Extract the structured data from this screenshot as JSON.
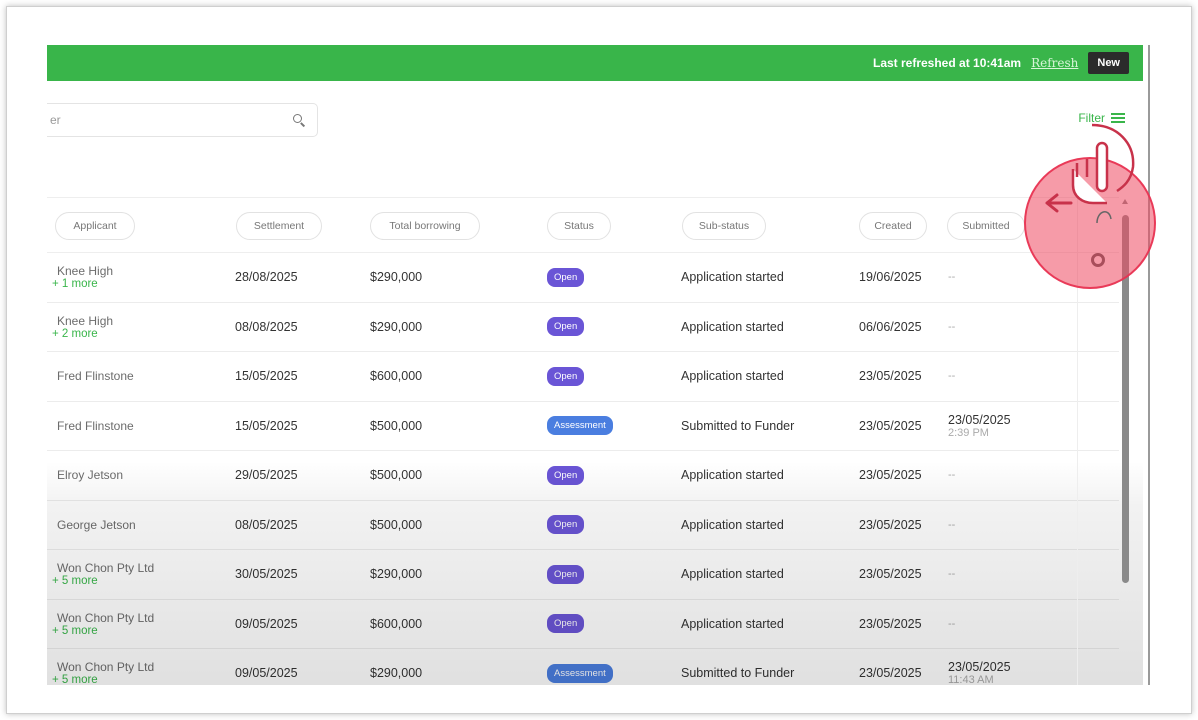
{
  "topbar": {
    "last_refreshed": "Last refreshed at 10:41am",
    "refresh_label": "Refresh",
    "new_label": "New",
    "color": "#39b54a"
  },
  "search": {
    "placeholder": "er"
  },
  "filter": {
    "label": "Filter"
  },
  "columns": [
    "Applicant",
    "Settlement",
    "Total borrowing",
    "Status",
    "Sub-status",
    "Created",
    "Submitted"
  ],
  "rows": [
    {
      "applicant": "Knee High",
      "more": "+ 1 more",
      "settlement": "28/08/2025",
      "borrowing": "$290,000",
      "status": "Open",
      "substatus": "Application started",
      "created": "19/06/2025",
      "submitted": "--",
      "submitted_time": ""
    },
    {
      "applicant": "Knee High",
      "more": "+ 2 more",
      "settlement": "08/08/2025",
      "borrowing": "$290,000",
      "status": "Open",
      "substatus": "Application started",
      "created": "06/06/2025",
      "submitted": "--",
      "submitted_time": ""
    },
    {
      "applicant": "Fred Flinstone",
      "more": "",
      "settlement": "15/05/2025",
      "borrowing": "$600,000",
      "status": "Open",
      "substatus": "Application started",
      "created": "23/05/2025",
      "submitted": "--",
      "submitted_time": ""
    },
    {
      "applicant": "Fred Flinstone",
      "more": "",
      "settlement": "15/05/2025",
      "borrowing": "$500,000",
      "status": "Assessment",
      "substatus": "Submitted to Funder",
      "created": "23/05/2025",
      "submitted": "23/05/2025",
      "submitted_time": "2:39 PM"
    },
    {
      "applicant": "Elroy Jetson",
      "more": "",
      "settlement": "29/05/2025",
      "borrowing": "$500,000",
      "status": "Open",
      "substatus": "Application started",
      "created": "23/05/2025",
      "submitted": "--",
      "submitted_time": ""
    },
    {
      "applicant": "George Jetson",
      "more": "",
      "settlement": "08/05/2025",
      "borrowing": "$500,000",
      "status": "Open",
      "substatus": "Application started",
      "created": "23/05/2025",
      "submitted": "--",
      "submitted_time": ""
    },
    {
      "applicant": "Won Chon Pty Ltd",
      "more": "+ 5 more",
      "settlement": "30/05/2025",
      "borrowing": "$290,000",
      "status": "Open",
      "substatus": "Application started",
      "created": "23/05/2025",
      "submitted": "--",
      "submitted_time": ""
    },
    {
      "applicant": "Won Chon Pty Ltd",
      "more": "+ 5 more",
      "settlement": "09/05/2025",
      "borrowing": "$600,000",
      "status": "Open",
      "substatus": "Application started",
      "created": "23/05/2025",
      "submitted": "--",
      "submitted_time": ""
    },
    {
      "applicant": "Won Chon Pty Ltd",
      "more": "+ 5 more",
      "settlement": "09/05/2025",
      "borrowing": "$290,000",
      "status": "Assessment",
      "substatus": "Submitted to Funder",
      "created": "23/05/2025",
      "submitted": "23/05/2025",
      "submitted_time": "11:43 AM"
    }
  ],
  "icons": {
    "search": "search-icon",
    "filter": "filter-icon",
    "settings": "gear-icon",
    "pointer": "hand-pointer-icon"
  },
  "colors": {
    "status_open": "#6a55d6",
    "status_assessment": "#4a7ee0",
    "highlight": "#ef4860"
  }
}
